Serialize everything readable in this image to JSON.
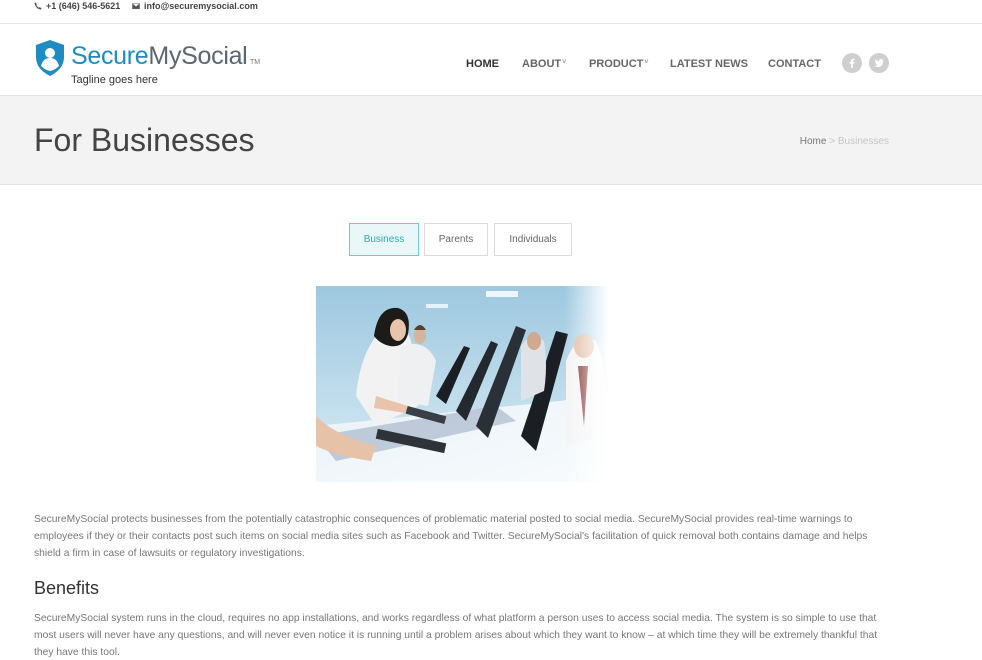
{
  "topbar": {
    "phone": "+1 (646) 546-5621",
    "email": "info@securemysocial.com"
  },
  "logo": {
    "name_part1": "Secure",
    "name_part2": "MySocial",
    "tm": "TM",
    "tagline": "Tagline goes here"
  },
  "nav": {
    "items": [
      {
        "label": "HOME",
        "has_caret": false,
        "active": true
      },
      {
        "label": "ABOUT",
        "has_caret": true,
        "active": false
      },
      {
        "label": "PRODUCT",
        "has_caret": true,
        "active": false
      },
      {
        "label": "LATEST NEWS",
        "has_caret": false,
        "active": false
      },
      {
        "label": "CONTACT",
        "has_caret": false,
        "active": false
      }
    ],
    "caret_glyph": "˅",
    "social": [
      "facebook-icon",
      "twitter-icon"
    ]
  },
  "title_band": {
    "title": "For Businesses",
    "breadcrumb_home": "Home",
    "breadcrumb_sep": ">",
    "breadcrumb_current": "Businesses"
  },
  "tabs": [
    {
      "label": "Business",
      "active": true
    },
    {
      "label": "Parents",
      "active": false
    },
    {
      "label": "Individuals",
      "active": false
    }
  ],
  "content": {
    "intro": "SecureMySocial protects businesses from the potentially catastrophic consequences of problematic material posted to social media. SecureMySocial provides real-time warnings to employees if they or their contacts post such items on social media sites such as Facebook and Twitter. SecureMySocial's facilitation of quick removal both contains damage and helps shield a firm in case of lawsuits or regulatory investigations.",
    "benefits_heading": "Benefits",
    "benefits_text": "SecureMySocial system runs in the cloud, requires no app installations, and works regardless of what platform a person uses to access social media. The system is so simple to use that most users will never have any questions, and will never even notice it is running until a problem arises about which they want to know – at which time they will be extremely thankful that they have this tool."
  },
  "colors": {
    "brand_blue": "#1e8bc3",
    "brand_grey": "#5a6670",
    "tab_active": "#2aa7b5",
    "title_band_bg": "#f3f3f3"
  }
}
